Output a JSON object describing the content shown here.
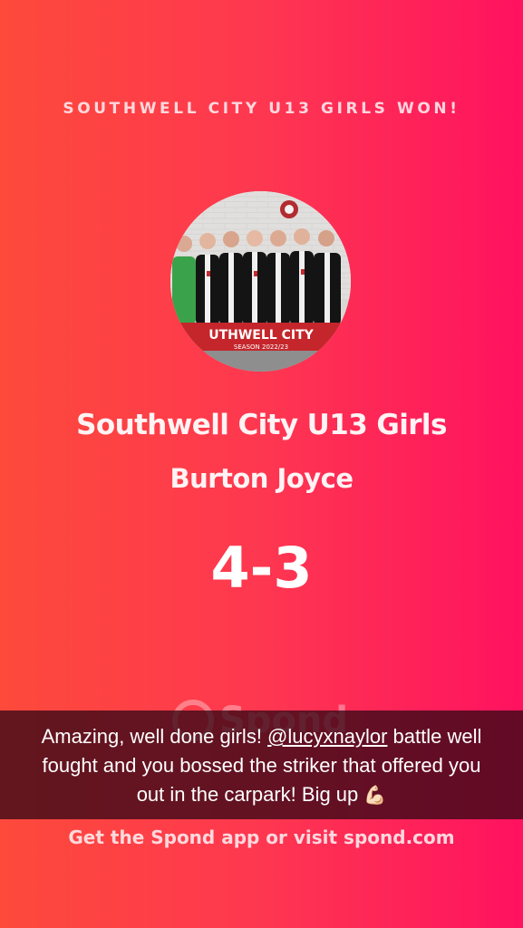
{
  "result": {
    "headline": "SOUTHWELL CITY U13 GIRLS WON!",
    "home_team": "Southwell City U13 Girls",
    "away_team": "Burton Joyce",
    "score": "4-3"
  },
  "team_photo": {
    "banner_text": "UTHWELL CITY",
    "banner_sub": "SEASON 2022/23"
  },
  "spond_watermark": {
    "brand": "Spond"
  },
  "caption": {
    "text_before": "Amazing, well done girls! ",
    "mention": "@lucyxnaylor",
    "text_after": " battle well fought and you bossed the striker that offered you out in the carpark! Big up ",
    "emoji": "💪🏻"
  },
  "footer": {
    "prefix": "Get the Spond app or visit ",
    "link": "spond.com"
  },
  "colors": {
    "gradient_left": "#fd4a3b",
    "gradient_right": "#ff1260",
    "caption_bg": "#370816"
  }
}
